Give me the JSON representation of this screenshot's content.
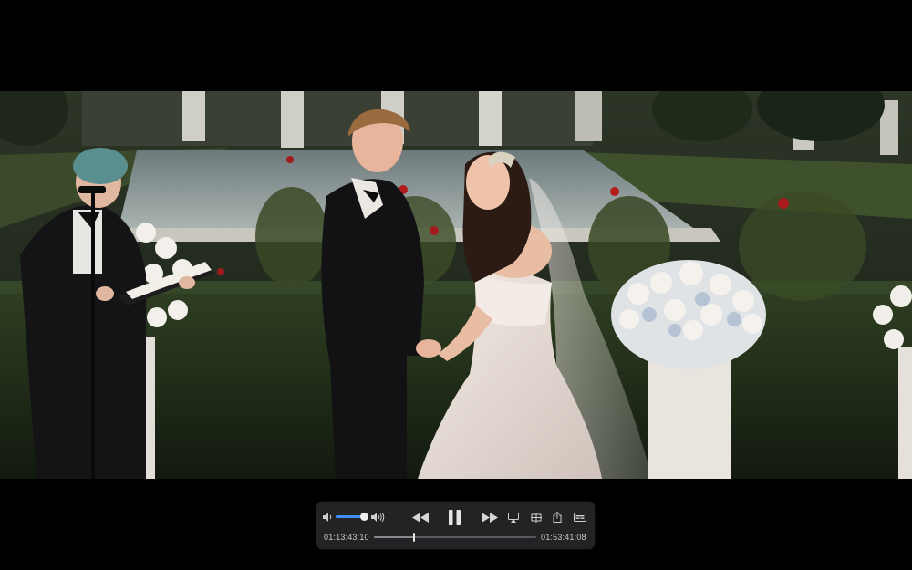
{
  "player": {
    "current_time": "01:13:43:10",
    "total_time": "01:53:41:08",
    "progress": 0.247,
    "volume": 0.95,
    "accent_color": "#3d8ef7"
  },
  "controls": {
    "icons": {
      "volume_low": "speaker-low-icon",
      "volume_high": "speaker-high-icon",
      "rewind": "rewind-icon",
      "pause": "pause-icon",
      "fast_forward": "fast-forward-icon",
      "airplay": "airplay-icon",
      "pip": "picture-in-picture-icon",
      "share": "share-icon",
      "subtitles": "subtitles-icon"
    }
  },
  "video": {
    "scene": "wedding-ceremony"
  }
}
